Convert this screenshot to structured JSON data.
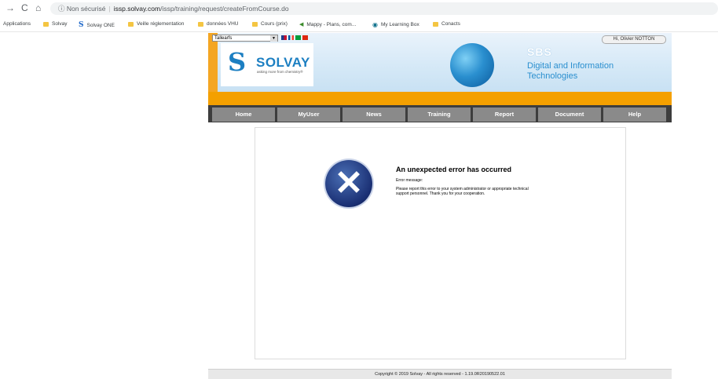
{
  "browser": {
    "back_glyph": "→",
    "reload_glyph": "C",
    "home_glyph": "⌂",
    "info_glyph": "ⓘ",
    "security_label": "Non sécurisé",
    "url_host": "issp.solvay.com",
    "url_path": "/issp/training/request/createFromCourse.do"
  },
  "bookmarks": [
    {
      "label": "Applications",
      "icon": "apps-icon"
    },
    {
      "label": "Solvay",
      "icon": "folder-icon"
    },
    {
      "label": "Solvay ONE",
      "icon": "solvay-s-icon"
    },
    {
      "label": "Veille réglementation",
      "icon": "folder-icon"
    },
    {
      "label": "données VHU",
      "icon": "folder-icon"
    },
    {
      "label": "Cours (prix)",
      "icon": "folder-icon"
    },
    {
      "label": "Mappy - Plans, com...",
      "icon": "mappy-icon"
    },
    {
      "label": "My Learning Box",
      "icon": "learning-box-icon"
    },
    {
      "label": "Conacts",
      "icon": "folder-icon"
    }
  ],
  "header": {
    "language_select": "Tallearfs",
    "user_button": "Hi, Olivier NOTTON",
    "logo_text": "SOLVAY",
    "logo_tagline": "asking more from chemistry®",
    "sbs": "SBS",
    "department_line1": "Digital and Information",
    "department_line2": "Technologies"
  },
  "menu": [
    "Home",
    "MyUser",
    "News",
    "Training",
    "Report",
    "Document",
    "Help"
  ],
  "error": {
    "title": "An unexpected error has occurred",
    "label": "Error message:",
    "body": "Please report this error to your system administrator or appropriate technical support personnel. Thank you for your cooperation."
  },
  "footer": "Copyright © 2019 Solvay - All rights reserved - 1.19.0R20190522.01",
  "colors": {
    "orange": "#f4a000",
    "menu_bg": "#3d3d3d",
    "menu_item": "#8a8a8a",
    "brand_blue": "#1c7fc2"
  }
}
